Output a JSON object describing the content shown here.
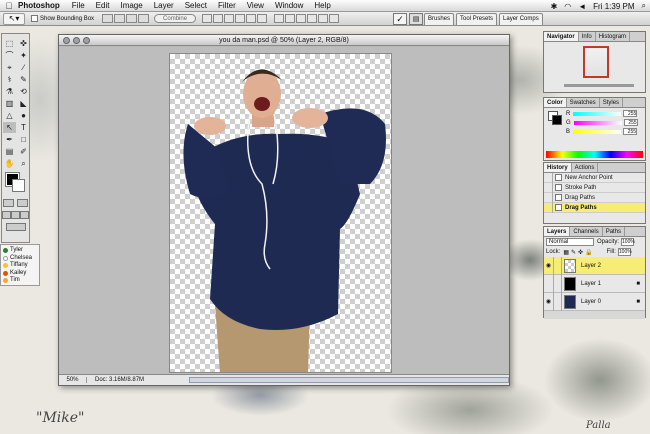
{
  "menubar": {
    "app_name": "Photoshop",
    "items": [
      "File",
      "Edit",
      "Image",
      "Layer",
      "Select",
      "Filter",
      "View",
      "Window",
      "Help"
    ],
    "clock": "Fri 1:39 PM"
  },
  "options_bar": {
    "show_bounding_box": "Show Bounding Box",
    "combine_label": "Combine",
    "palette_tabs": [
      "Brushes",
      "Tool Presets",
      "Layer Comps"
    ]
  },
  "document": {
    "title": "you da man.psd @ 50% (Layer 2, RGB/8)",
    "zoom": "50%",
    "doc_info": "Doc: 3.16M/8.87M"
  },
  "left_list": {
    "names": [
      "Tyler",
      "Chelsea",
      "Tiffany",
      "Kailey",
      "Tim"
    ],
    "colors": [
      "#2e7d32",
      "#ffffff",
      "#fbc02d",
      "#e65100",
      "#f9a825"
    ]
  },
  "navigator": {
    "tabs": [
      "Navigator",
      "Info",
      "Histogram"
    ]
  },
  "color_palette": {
    "tabs": [
      "Color",
      "Swatches",
      "Styles"
    ],
    "channels": [
      {
        "label": "R",
        "value": "255"
      },
      {
        "label": "G",
        "value": "255"
      },
      {
        "label": "B",
        "value": "255"
      }
    ]
  },
  "history": {
    "tabs": [
      "History",
      "Actions"
    ],
    "items": [
      "New Anchor Point",
      "Stroke Path",
      "Drag Paths",
      "Drag Paths"
    ]
  },
  "layers": {
    "tabs": [
      "Layers",
      "Channels",
      "Paths"
    ],
    "blend_mode": "Normal",
    "opacity_label": "Opacity:",
    "opacity": "100%",
    "lock_label": "Lock:",
    "fill_label": "Fill:",
    "fill": "100%",
    "items": [
      "Layer 2",
      "Layer 1",
      "Layer 0"
    ]
  },
  "desktop": {
    "signature_left": "\"Mike\"",
    "signature_right": "Palla"
  }
}
